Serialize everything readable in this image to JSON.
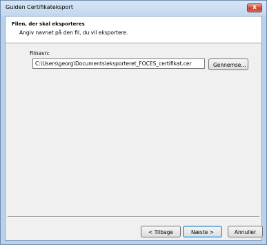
{
  "window": {
    "title": "Guiden Certifikateksport",
    "close_label": "x"
  },
  "header": {
    "title": "Filen, der skal eksporteres",
    "subtitle": "Angiv navnet på den fil, du vil eksportere."
  },
  "form": {
    "filename_label": "Filnavn:",
    "filename_value": "C:\\Users\\georg\\Documents\\eksporteret_FOCES_certifikat.cer",
    "browse_label": "Gennemse..."
  },
  "footer": {
    "back_label": "< Tilbage",
    "next_label": "Næste >",
    "cancel_label": "Annuller"
  }
}
